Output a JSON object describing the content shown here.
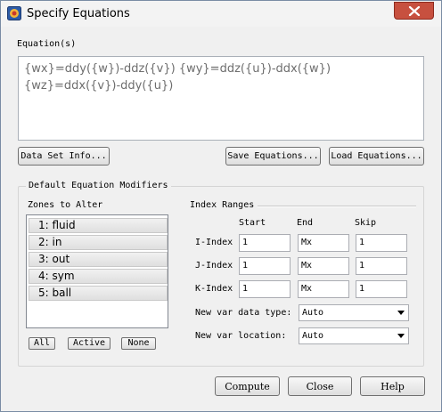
{
  "window": {
    "title": "Specify Equations"
  },
  "equation": {
    "label": "Equation(s)",
    "text": "{wx}=ddy({w})-ddz({v}) {wy}=ddz({u})-ddx({w}) {wz}=ddx({v})-ddy({u})"
  },
  "buttons": {
    "data_set_info": "Data Set Info...",
    "save_equations": "Save Equations...",
    "load_equations": "Load Equations...",
    "compute": "Compute",
    "close": "Close",
    "help": "Help"
  },
  "modifiers": {
    "group_title": "Default Equation Modifiers",
    "zones_label": "Zones to Alter",
    "zones": [
      "1: fluid",
      "2: in",
      "3: out",
      "4: sym",
      "5: ball"
    ],
    "zone_buttons": {
      "all": "All",
      "active": "Active",
      "none": "None"
    },
    "index_ranges": {
      "title": "Index Ranges",
      "headers": {
        "start": "Start",
        "end": "End",
        "skip": "Skip"
      },
      "rows": [
        {
          "label": "I-Index",
          "start": "1",
          "end": "Mx",
          "skip": "1"
        },
        {
          "label": "J-Index",
          "start": "1",
          "end": "Mx",
          "skip": "1"
        },
        {
          "label": "K-Index",
          "start": "1",
          "end": "Mx",
          "skip": "1"
        }
      ]
    },
    "new_var_data_type": {
      "label": "New var data type:",
      "value": "Auto"
    },
    "new_var_location": {
      "label": "New var location:",
      "value": "Auto"
    }
  }
}
